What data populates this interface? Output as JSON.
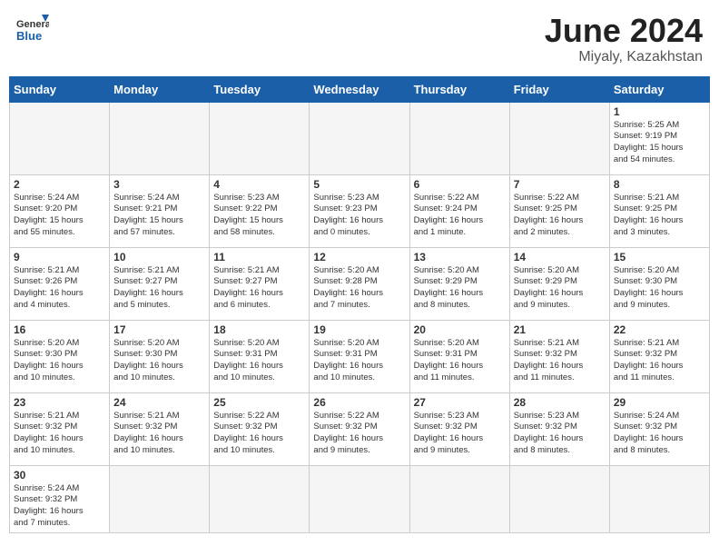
{
  "header": {
    "logo_general": "General",
    "logo_blue": "Blue",
    "month_title": "June 2024",
    "location": "Miyaly, Kazakhstan"
  },
  "days_of_week": [
    "Sunday",
    "Monday",
    "Tuesday",
    "Wednesday",
    "Thursday",
    "Friday",
    "Saturday"
  ],
  "weeks": [
    [
      {
        "day": "",
        "info": ""
      },
      {
        "day": "",
        "info": ""
      },
      {
        "day": "",
        "info": ""
      },
      {
        "day": "",
        "info": ""
      },
      {
        "day": "",
        "info": ""
      },
      {
        "day": "",
        "info": ""
      },
      {
        "day": "1",
        "info": "Sunrise: 5:25 AM\nSunset: 9:19 PM\nDaylight: 15 hours\nand 54 minutes."
      }
    ],
    [
      {
        "day": "2",
        "info": "Sunrise: 5:24 AM\nSunset: 9:20 PM\nDaylight: 15 hours\nand 55 minutes."
      },
      {
        "day": "3",
        "info": "Sunrise: 5:24 AM\nSunset: 9:21 PM\nDaylight: 15 hours\nand 57 minutes."
      },
      {
        "day": "4",
        "info": "Sunrise: 5:23 AM\nSunset: 9:22 PM\nDaylight: 15 hours\nand 58 minutes."
      },
      {
        "day": "5",
        "info": "Sunrise: 5:23 AM\nSunset: 9:23 PM\nDaylight: 16 hours\nand 0 minutes."
      },
      {
        "day": "6",
        "info": "Sunrise: 5:22 AM\nSunset: 9:24 PM\nDaylight: 16 hours\nand 1 minute."
      },
      {
        "day": "7",
        "info": "Sunrise: 5:22 AM\nSunset: 9:25 PM\nDaylight: 16 hours\nand 2 minutes."
      },
      {
        "day": "8",
        "info": "Sunrise: 5:21 AM\nSunset: 9:25 PM\nDaylight: 16 hours\nand 3 minutes."
      }
    ],
    [
      {
        "day": "9",
        "info": "Sunrise: 5:21 AM\nSunset: 9:26 PM\nDaylight: 16 hours\nand 4 minutes."
      },
      {
        "day": "10",
        "info": "Sunrise: 5:21 AM\nSunset: 9:27 PM\nDaylight: 16 hours\nand 5 minutes."
      },
      {
        "day": "11",
        "info": "Sunrise: 5:21 AM\nSunset: 9:27 PM\nDaylight: 16 hours\nand 6 minutes."
      },
      {
        "day": "12",
        "info": "Sunrise: 5:20 AM\nSunset: 9:28 PM\nDaylight: 16 hours\nand 7 minutes."
      },
      {
        "day": "13",
        "info": "Sunrise: 5:20 AM\nSunset: 9:29 PM\nDaylight: 16 hours\nand 8 minutes."
      },
      {
        "day": "14",
        "info": "Sunrise: 5:20 AM\nSunset: 9:29 PM\nDaylight: 16 hours\nand 9 minutes."
      },
      {
        "day": "15",
        "info": "Sunrise: 5:20 AM\nSunset: 9:30 PM\nDaylight: 16 hours\nand 9 minutes."
      }
    ],
    [
      {
        "day": "16",
        "info": "Sunrise: 5:20 AM\nSunset: 9:30 PM\nDaylight: 16 hours\nand 10 minutes."
      },
      {
        "day": "17",
        "info": "Sunrise: 5:20 AM\nSunset: 9:30 PM\nDaylight: 16 hours\nand 10 minutes."
      },
      {
        "day": "18",
        "info": "Sunrise: 5:20 AM\nSunset: 9:31 PM\nDaylight: 16 hours\nand 10 minutes."
      },
      {
        "day": "19",
        "info": "Sunrise: 5:20 AM\nSunset: 9:31 PM\nDaylight: 16 hours\nand 10 minutes."
      },
      {
        "day": "20",
        "info": "Sunrise: 5:20 AM\nSunset: 9:31 PM\nDaylight: 16 hours\nand 11 minutes."
      },
      {
        "day": "21",
        "info": "Sunrise: 5:21 AM\nSunset: 9:32 PM\nDaylight: 16 hours\nand 11 minutes."
      },
      {
        "day": "22",
        "info": "Sunrise: 5:21 AM\nSunset: 9:32 PM\nDaylight: 16 hours\nand 11 minutes."
      }
    ],
    [
      {
        "day": "23",
        "info": "Sunrise: 5:21 AM\nSunset: 9:32 PM\nDaylight: 16 hours\nand 10 minutes."
      },
      {
        "day": "24",
        "info": "Sunrise: 5:21 AM\nSunset: 9:32 PM\nDaylight: 16 hours\nand 10 minutes."
      },
      {
        "day": "25",
        "info": "Sunrise: 5:22 AM\nSunset: 9:32 PM\nDaylight: 16 hours\nand 10 minutes."
      },
      {
        "day": "26",
        "info": "Sunrise: 5:22 AM\nSunset: 9:32 PM\nDaylight: 16 hours\nand 9 minutes."
      },
      {
        "day": "27",
        "info": "Sunrise: 5:23 AM\nSunset: 9:32 PM\nDaylight: 16 hours\nand 9 minutes."
      },
      {
        "day": "28",
        "info": "Sunrise: 5:23 AM\nSunset: 9:32 PM\nDaylight: 16 hours\nand 8 minutes."
      },
      {
        "day": "29",
        "info": "Sunrise: 5:24 AM\nSunset: 9:32 PM\nDaylight: 16 hours\nand 8 minutes."
      }
    ],
    [
      {
        "day": "30",
        "info": "Sunrise: 5:24 AM\nSunset: 9:32 PM\nDaylight: 16 hours\nand 7 minutes."
      },
      {
        "day": "",
        "info": ""
      },
      {
        "day": "",
        "info": ""
      },
      {
        "day": "",
        "info": ""
      },
      {
        "day": "",
        "info": ""
      },
      {
        "day": "",
        "info": ""
      },
      {
        "day": "",
        "info": ""
      }
    ]
  ]
}
